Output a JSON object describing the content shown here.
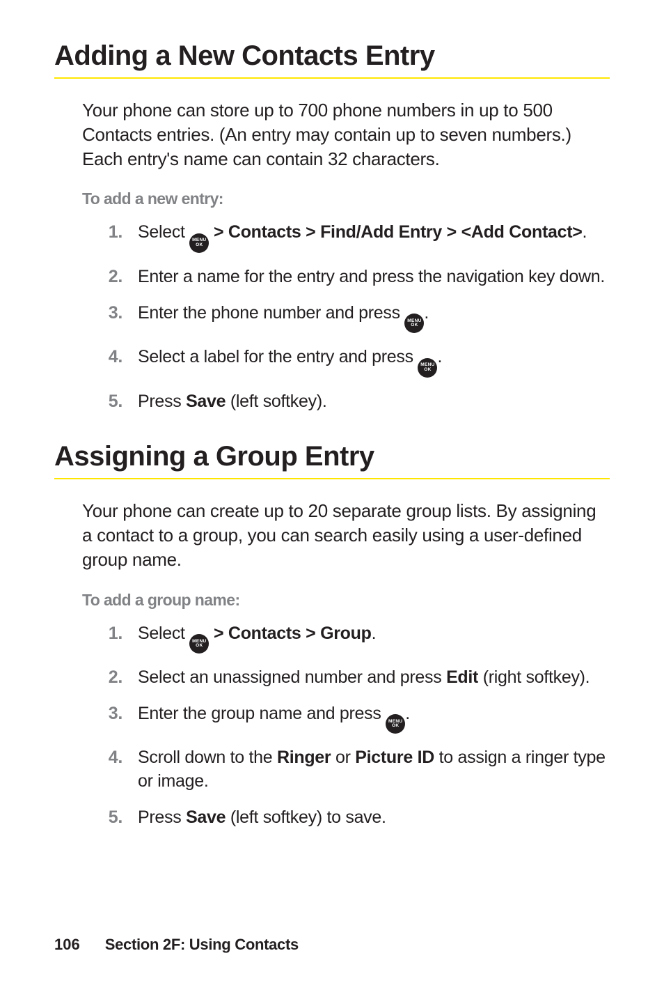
{
  "section1": {
    "heading": "Adding a New Contacts Entry",
    "intro": "Your phone can store up to 700 phone numbers in up to 500 Contacts entries. (An entry may contain up to seven numbers.) Each entry's name can contain 32 characters.",
    "subheading": "To add a new entry:",
    "steps": {
      "s1_num": "1.",
      "s1_a": "Select ",
      "s1_b": " > Contacts > Find/Add Entry > <Add Contact>",
      "s1_c": ".",
      "s2_num": "2.",
      "s2": "Enter a name for the entry and press the navigation key down.",
      "s3_num": "3.",
      "s3_a": "Enter the phone number and press ",
      "s3_b": ".",
      "s4_num": "4.",
      "s4_a": "Select a label for the entry and press ",
      "s4_b": ".",
      "s5_num": "5.",
      "s5_a": "Press ",
      "s5_b": "Save",
      "s5_c": " (left softkey)."
    }
  },
  "section2": {
    "heading": "Assigning a Group Entry",
    "intro": "Your phone can create up to 20 separate group lists. By assigning a contact to a group, you can search easily using a user-defined group name.",
    "subheading": "To add a group name:",
    "steps": {
      "s1_num": "1.",
      "s1_a": "Select ",
      "s1_b": " > Contacts > Group",
      "s1_c": ".",
      "s2_num": "2.",
      "s2_a": "Select an unassigned number and press ",
      "s2_b": "Edit",
      "s2_c": " (right softkey).",
      "s3_num": "3.",
      "s3_a": "Enter the group name and press ",
      "s3_b": ".",
      "s4_num": "4.",
      "s4_a": "Scroll down to the ",
      "s4_b": "Ringer",
      "s4_c": " or ",
      "s4_d": "Picture ID",
      "s4_e": " to assign a ringer type or image.",
      "s5_num": "5.",
      "s5_a": "Press ",
      "s5_b": "Save",
      "s5_c": " (left softkey) to save."
    }
  },
  "icon": {
    "line1": "MENU",
    "line2": "OK"
  },
  "footer": {
    "page": "106",
    "section": "Section 2F: Using Contacts"
  }
}
